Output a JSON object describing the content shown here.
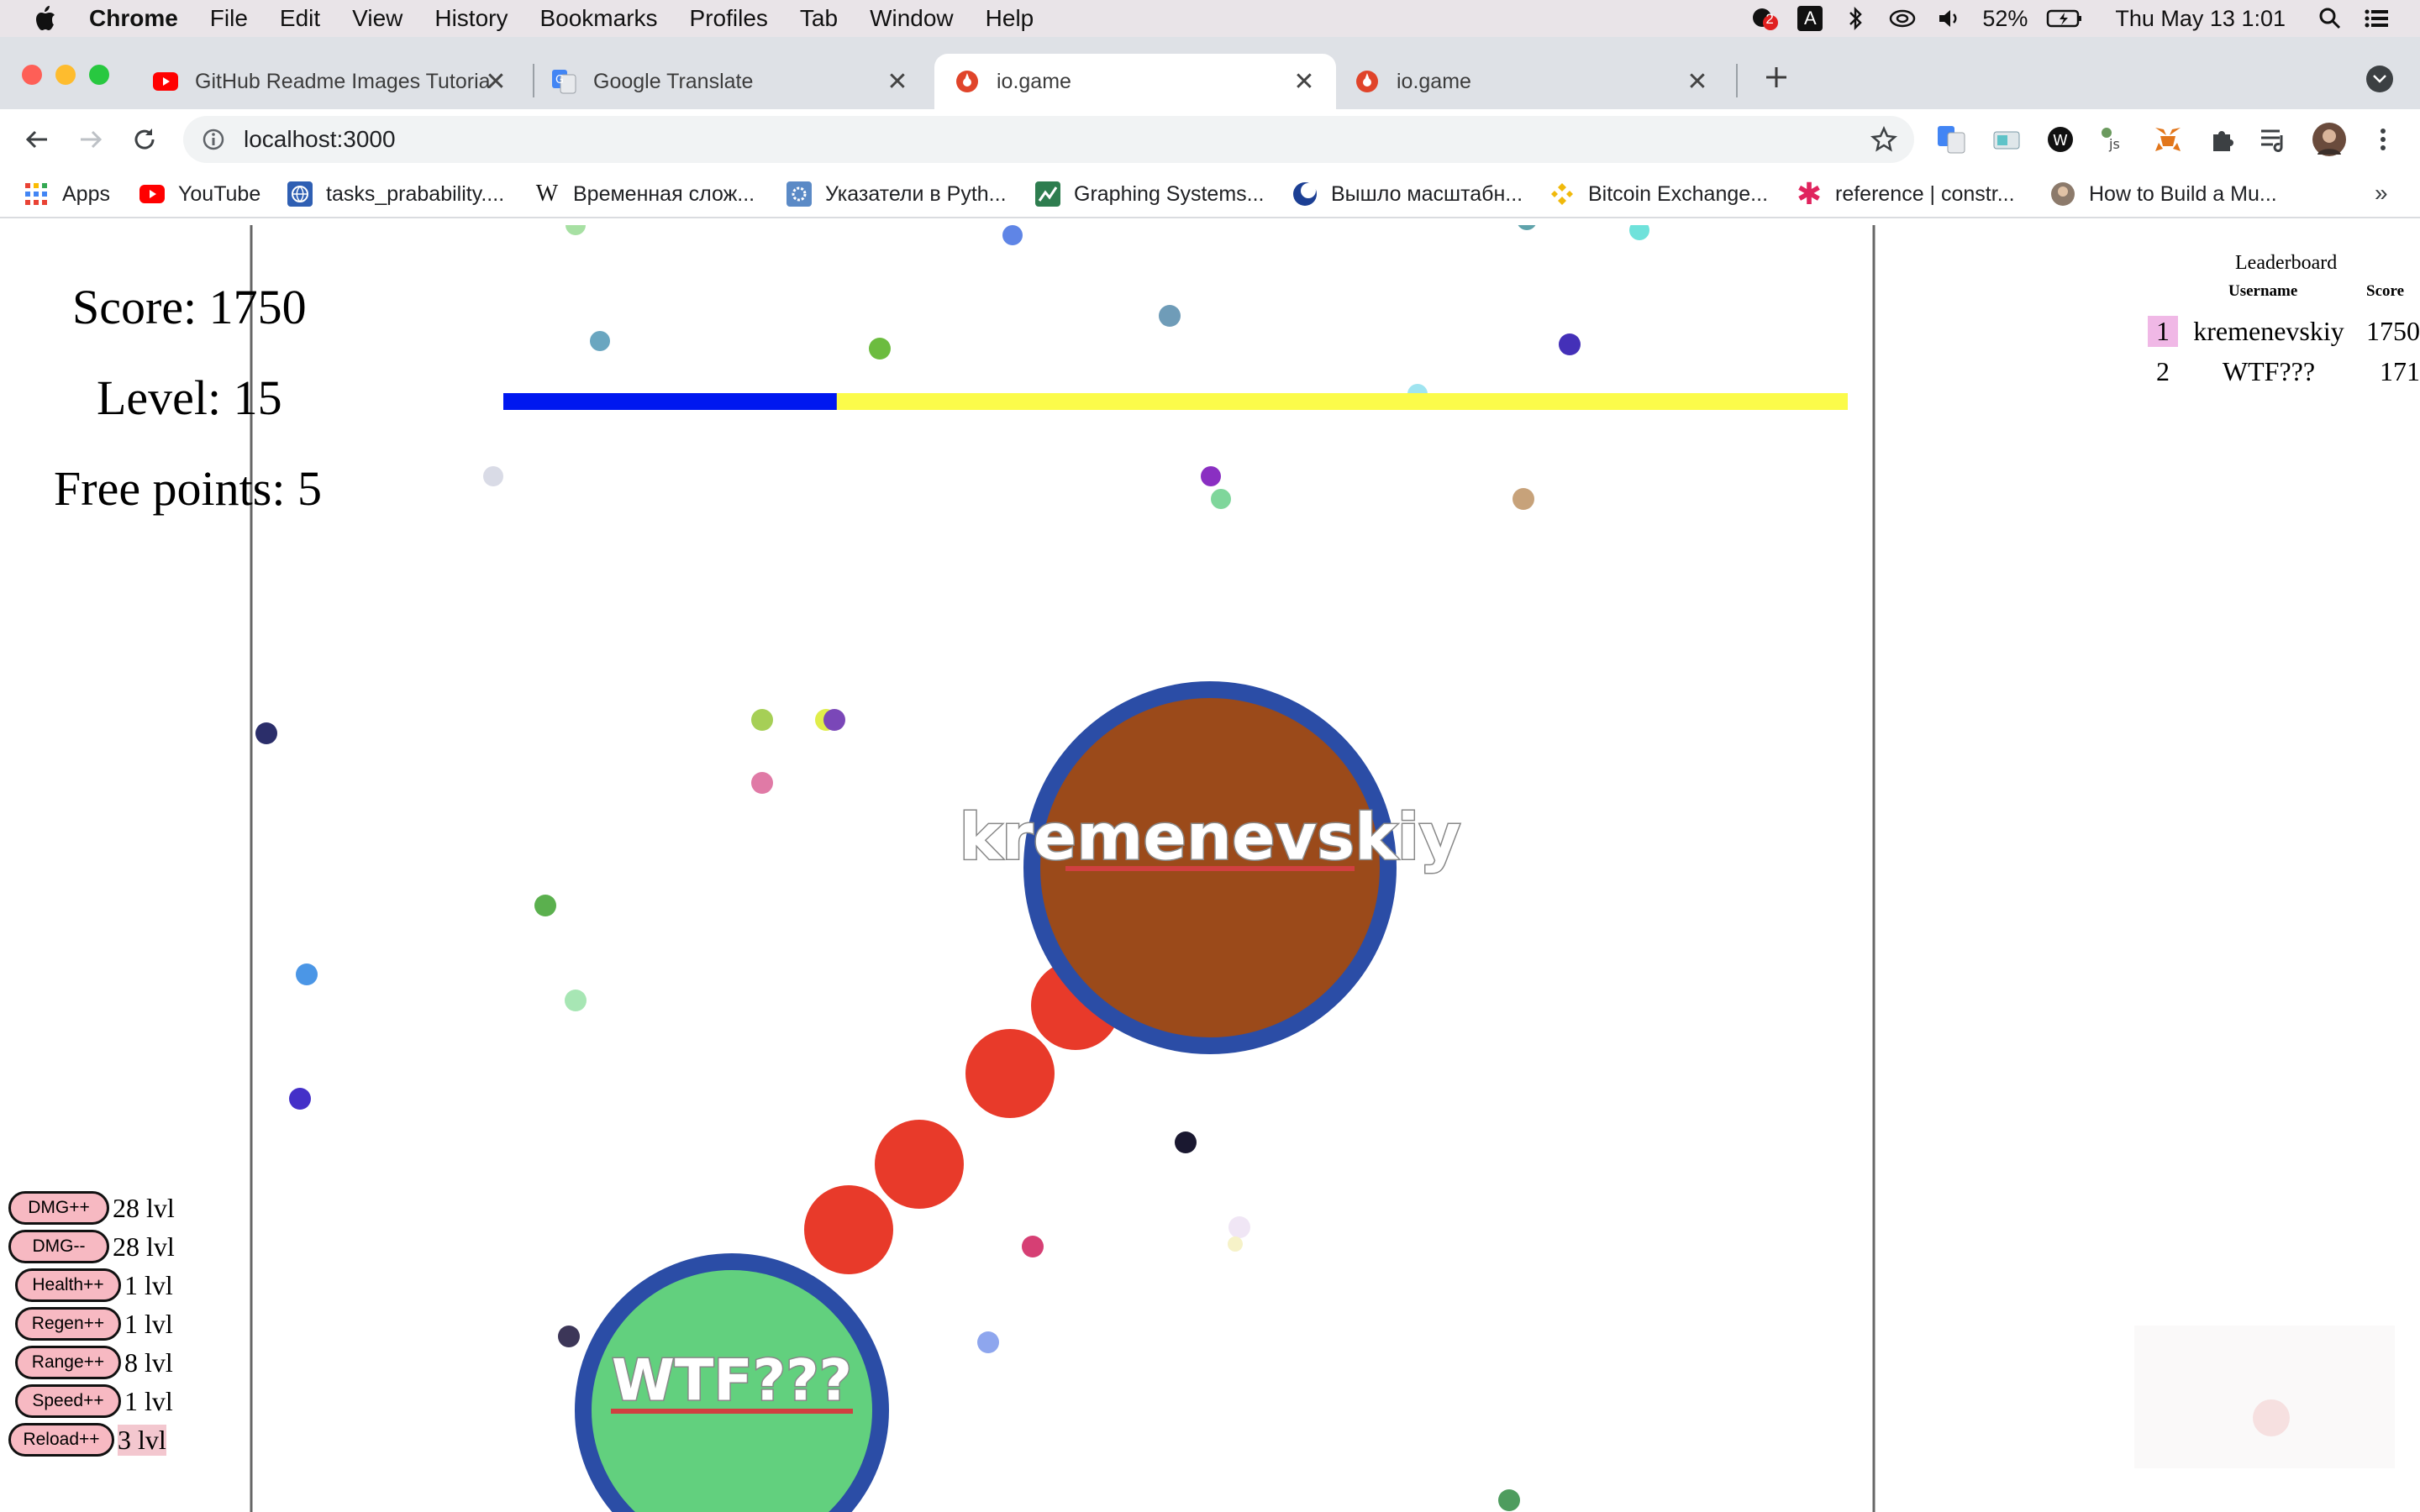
{
  "menubar": {
    "app_name": "Chrome",
    "items": [
      "File",
      "Edit",
      "View",
      "History",
      "Bookmarks",
      "Profiles",
      "Tab",
      "Window",
      "Help"
    ],
    "notification_count": "2",
    "input_source": "A",
    "battery": "52%",
    "datetime": "Thu May 13  1:01"
  },
  "tabs": [
    {
      "title": "GitHub Readme Images Tutoria",
      "icon": "youtube-icon",
      "active": false
    },
    {
      "title": "Google Translate",
      "icon": "google-translate-icon",
      "active": false
    },
    {
      "title": "io.game",
      "icon": "io-game-icon",
      "active": true
    },
    {
      "title": "io.game",
      "icon": "io-game-icon",
      "active": false
    }
  ],
  "omnibox": {
    "url": "localhost:3000"
  },
  "bookmarks": [
    {
      "label": "Apps",
      "icon": "apps-grid-icon"
    },
    {
      "label": "YouTube",
      "icon": "youtube-icon"
    },
    {
      "label": "tasks_prabability....",
      "icon": "globe-icon"
    },
    {
      "label": "Временная слож...",
      "icon": "wikipedia-icon"
    },
    {
      "label": "Указатели в Pyth...",
      "icon": "gear-icon"
    },
    {
      "label": "Graphing Systems...",
      "icon": "graph-icon"
    },
    {
      "label": "Вышло масштабн...",
      "icon": "moon-icon"
    },
    {
      "label": "Bitcoin Exchange...",
      "icon": "binance-icon"
    },
    {
      "label": "reference | constr...",
      "icon": "asterisk-icon"
    },
    {
      "label": "How to Build a Mu...",
      "icon": "avatar-icon"
    }
  ],
  "hud": {
    "score": "Score: 1750",
    "level": "Level: 15",
    "free_points": "Free points: 5",
    "xp_progress": 0.248
  },
  "leaderboard": {
    "title": "Leaderboard",
    "col_username": "Username",
    "col_score": "Score",
    "rows": [
      {
        "rank": "1",
        "username": "kremenevskiy",
        "score": "1750"
      },
      {
        "rank": "2",
        "username": "WTF???",
        "score": "171"
      }
    ]
  },
  "upgrades": [
    {
      "label": "DMG++",
      "level": "28 lvl"
    },
    {
      "label": "DMG--",
      "level": "28 lvl"
    },
    {
      "label": "Health++",
      "level": "1 lvl"
    },
    {
      "label": "Regen++",
      "level": "1 lvl"
    },
    {
      "label": "Range++",
      "level": "8 lvl"
    },
    {
      "label": "Speed++",
      "level": "1 lvl"
    },
    {
      "label": "Reload++",
      "level": "3 lvl"
    }
  ],
  "players": [
    {
      "name": "kremenevskiy",
      "fill": "#9b4a1a",
      "border": "#2b4da6"
    },
    {
      "name": "WTF???",
      "fill": "#62d07e",
      "border": "#2b4da6"
    }
  ],
  "colors": {
    "xp_bar_fill": "#0018f0",
    "xp_bar_track": "#fbfb4a",
    "bullet": "#e83a2a",
    "player_border": "#2b4da6",
    "name_underline": "#d04040",
    "upgrade_button": "#f7b9c2"
  }
}
